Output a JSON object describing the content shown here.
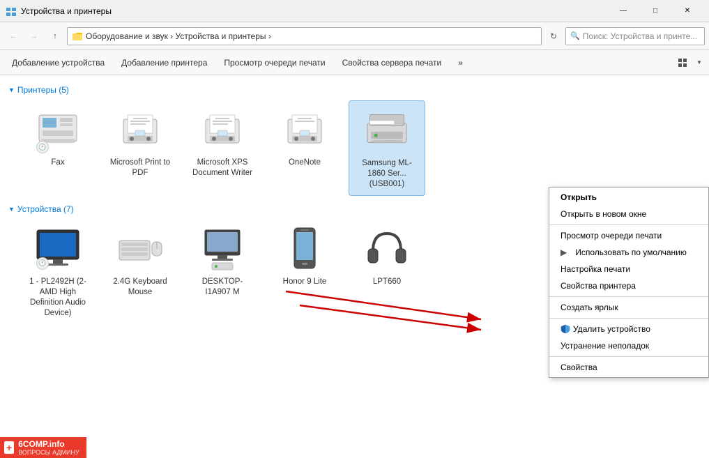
{
  "window": {
    "title": "Устройства и принтеры",
    "min_btn": "—",
    "max_btn": "□",
    "close_btn": "✕"
  },
  "addressbar": {
    "back": "←",
    "forward": "→",
    "up": "↑",
    "path": "Оборудование и звук › Устройства и принтеры ›",
    "search_placeholder": "Поиск: Устройства и принте...",
    "refresh": "↻"
  },
  "toolbar": {
    "add_device": "Добавление устройства",
    "add_printer": "Добавление принтера",
    "view_queue": "Просмотр очереди печати",
    "server_props": "Свойства сервера печати",
    "more": "»"
  },
  "printers_section": {
    "label": "Принтеры (5)",
    "items": [
      {
        "id": "fax",
        "name": "Fax",
        "type": "fax"
      },
      {
        "id": "ms-print-pdf",
        "name": "Microsoft Print to PDF",
        "type": "printer"
      },
      {
        "id": "ms-xps",
        "name": "Microsoft XPS Document Writer",
        "type": "printer"
      },
      {
        "id": "onenote",
        "name": "OneNote",
        "type": "printer"
      },
      {
        "id": "samsung",
        "name": "Samsung ML-1860 Ser... (USB001)",
        "type": "printer_selected"
      }
    ]
  },
  "devices_section": {
    "label": "Устройства (7)",
    "items": [
      {
        "id": "monitor",
        "name": "1 - PL2492H (2-AMD High Definition Audio Device)",
        "type": "monitor"
      },
      {
        "id": "keyboard",
        "name": "2.4G Keyboard Mouse",
        "type": "keyboard"
      },
      {
        "id": "desktop",
        "name": "DESKTOP-I1A907 M",
        "type": "desktop"
      },
      {
        "id": "phone",
        "name": "Honor 9 Lite",
        "type": "phone"
      },
      {
        "id": "lpt660",
        "name": "LPT660",
        "type": "headphones"
      }
    ]
  },
  "context_menu": {
    "items": [
      {
        "id": "open",
        "label": "Открыть",
        "bold": true,
        "icon": null
      },
      {
        "id": "open-new",
        "label": "Открыть в новом окне",
        "bold": false,
        "icon": null
      },
      {
        "id": "divider1",
        "type": "divider"
      },
      {
        "id": "view-queue",
        "label": "Просмотр очереди печати",
        "bold": false,
        "icon": null
      },
      {
        "id": "set-default",
        "label": "Использовать по умолчанию",
        "bold": false,
        "icon": null
      },
      {
        "id": "print-settings",
        "label": "Настройка печати",
        "bold": false,
        "icon": null
      },
      {
        "id": "printer-props",
        "label": "Свойства принтера",
        "bold": false,
        "icon": null
      },
      {
        "id": "divider2",
        "type": "divider"
      },
      {
        "id": "create-shortcut",
        "label": "Создать ярлык",
        "bold": false,
        "icon": null
      },
      {
        "id": "divider3",
        "type": "divider"
      },
      {
        "id": "remove-device",
        "label": "Удалить устройство",
        "bold": false,
        "icon": "shield"
      },
      {
        "id": "troubleshoot",
        "label": "Устранение неполадок",
        "bold": false,
        "icon": null
      },
      {
        "id": "divider4",
        "type": "divider"
      },
      {
        "id": "properties",
        "label": "Свойства",
        "bold": false,
        "icon": null
      }
    ]
  },
  "watermark": {
    "icon": "+",
    "text": "6COMP.info",
    "subtext": "ВОПРОСЫ АДМИНУ"
  }
}
